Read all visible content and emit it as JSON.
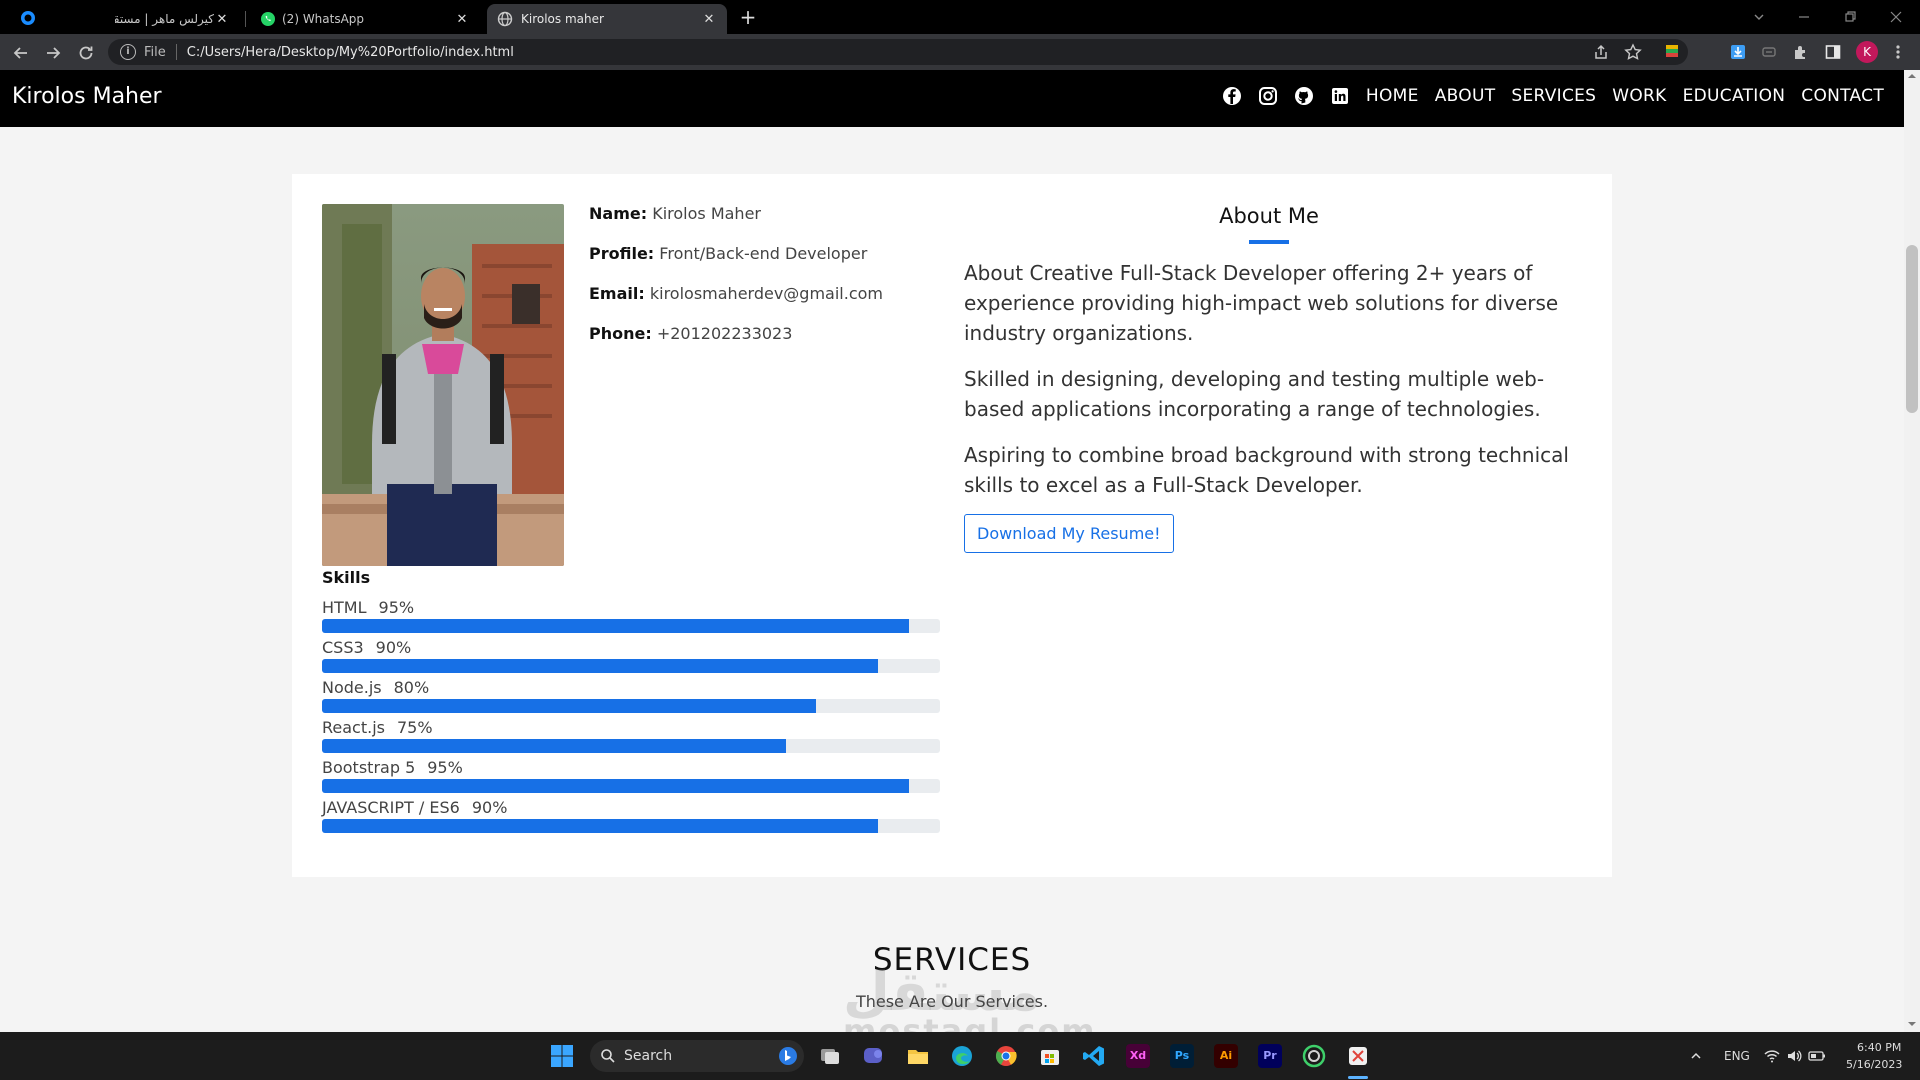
{
  "browser": {
    "tabs": [
      {
        "title": "كيرلس ماهر | مستقل",
        "active": false
      },
      {
        "title": "(2) WhatsApp",
        "active": false
      },
      {
        "title": "Kirolos maher",
        "active": true
      }
    ],
    "new_tab": "+",
    "omnibox": {
      "scheme_label": "File",
      "url": "C:/Users/Hera/Desktop/My%20Portfolio/index.html"
    },
    "profile_initial": "K"
  },
  "site": {
    "brand": "Kirolos Maher",
    "nav": [
      "HOME",
      "ABOUT",
      "SERVICES",
      "WORK",
      "EDUCATION",
      "CONTACT"
    ],
    "social": [
      "facebook-icon",
      "instagram-icon",
      "github-icon",
      "linkedin-icon"
    ]
  },
  "profile": {
    "name_label": "Name:",
    "name": "Kirolos Maher",
    "profile_label": "Profile:",
    "profile": "Front/Back-end Developer",
    "email_label": "Email:",
    "email": "kirolosmaherdev@gmail.com",
    "phone_label": "Phone:",
    "phone": "+201202233023"
  },
  "about": {
    "title": "About Me",
    "paragraphs": [
      "About Creative Full-Stack Developer offering 2+ years of experience providing high-impact web solutions for diverse industry organizations.",
      "Skilled in designing, developing and testing multiple web-based applications incorporating a range of technologies.",
      "Aspiring to combine broad background with strong technical skills to excel as a Full-Stack Developer."
    ],
    "resume_button": "Download My Resume!"
  },
  "skills": {
    "title": "Skills",
    "items": [
      {
        "name": "HTML",
        "percent_label": "95%",
        "level": 95
      },
      {
        "name": "CSS3",
        "percent_label": "90%",
        "level": 90
      },
      {
        "name": "Node.js",
        "percent_label": "80%",
        "level": 80
      },
      {
        "name": "React.js",
        "percent_label": "75%",
        "level": 75
      },
      {
        "name": "Bootstrap 5",
        "percent_label": "95%",
        "level": 95
      },
      {
        "name": "JAVASCRIPT / ES6",
        "percent_label": "90%",
        "level": 90
      }
    ]
  },
  "services": {
    "title": "SERVICES",
    "subtitle": "These Are Our Services."
  },
  "watermark": {
    "arabic": "مستقل",
    "latin": "mostaql.com"
  },
  "taskbar": {
    "search_label": "Search",
    "apps": [
      "Xd",
      "Ps",
      "Ai",
      "Pr"
    ],
    "language": "ENG",
    "time": "6:40 PM",
    "date": "5/16/2023"
  },
  "colors": {
    "accent": "#1770e6",
    "nav_bg": "#000000",
    "page_bg": "#f4f4f4"
  }
}
